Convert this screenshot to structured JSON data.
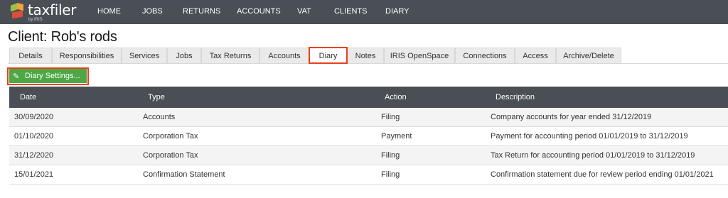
{
  "brand": {
    "name": "taxfiler",
    "sub": "by IRIS",
    "logo_colors": [
      "#9cc145",
      "#f0a43a",
      "#d94f3a"
    ]
  },
  "nav": {
    "items": [
      "HOME",
      "JOBS",
      "RETURNS",
      "ACCOUNTS",
      "VAT",
      "CLIENTS",
      "DIARY"
    ]
  },
  "page": {
    "title": "Client: Rob's rods"
  },
  "tabs": {
    "items": [
      "Details",
      "Responsibilities",
      "Services",
      "Jobs",
      "Tax Returns",
      "Accounts",
      "Diary",
      "Notes",
      "IRIS OpenSpace",
      "Connections",
      "Access",
      "Archive/Delete"
    ],
    "active": "Diary"
  },
  "toolbar": {
    "diary_settings_label": "Diary Settings...",
    "diary_settings_icon": "pencil-icon",
    "accent": "#4ea745",
    "highlight": "#e8401c"
  },
  "table": {
    "headers": [
      "Date",
      "Type",
      "Action",
      "Description"
    ],
    "rows": [
      [
        "30/09/2020",
        "Accounts",
        "Filing",
        "Company accounts for year ended 31/12/2019"
      ],
      [
        "01/10/2020",
        "Corporation Tax",
        "Payment",
        "Payment for accounting period 01/01/2019 to 31/12/2019"
      ],
      [
        "31/12/2020",
        "Corporation Tax",
        "Filing",
        "Tax Return for accounting period 01/01/2019 to 31/12/2019"
      ],
      [
        "15/01/2021",
        "Confirmation Statement",
        "Filing",
        "Confirmation statement due for review period ending 01/01/2021"
      ]
    ]
  }
}
